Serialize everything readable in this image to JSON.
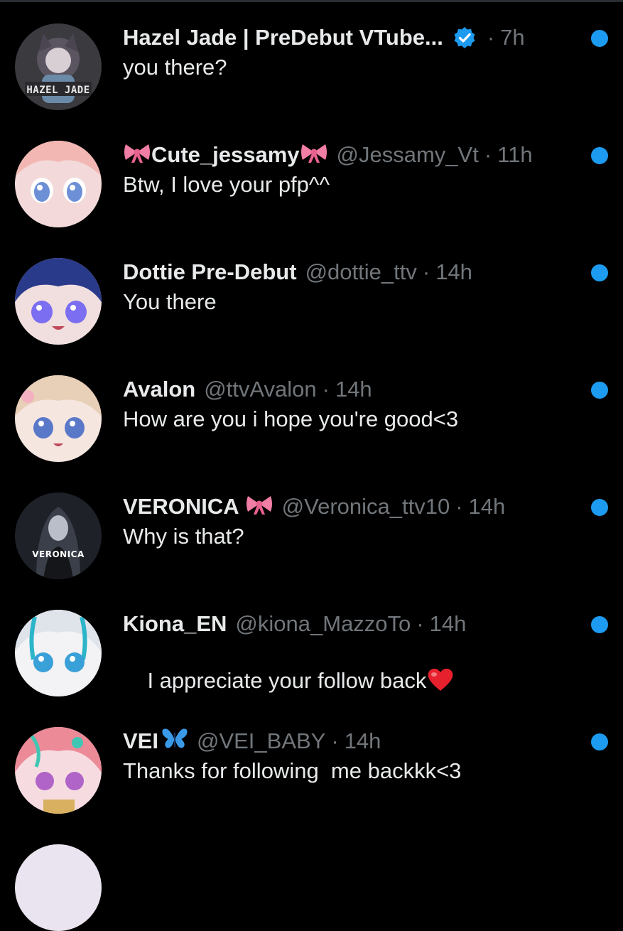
{
  "conversations": [
    {
      "name": "Hazel Jade | PreDebut VTube...",
      "verified": true,
      "handle": "",
      "time": "7h",
      "preview": "you there?",
      "avatar_caption": "HAZEL JADE",
      "unread": true
    },
    {
      "name": "Cute_jessamy",
      "name_emoji": "ribbon-emoji",
      "handle": "@Jessamy_Vt",
      "time": "11h",
      "preview": "Btw, I love your pfp^^",
      "unread": true
    },
    {
      "name": "Dottie Pre-Debut",
      "handle": "@dottie_ttv",
      "time": "14h",
      "preview": "You there",
      "unread": true
    },
    {
      "name": "Avalon",
      "handle": "@ttvAvalon",
      "time": "14h",
      "preview": "How are you i hope you're good<3",
      "unread": true
    },
    {
      "name": "VERONICA",
      "name_emoji": "ribbon-emoji",
      "handle": "@Veronica_ttv10",
      "time": "14h",
      "preview": "Why is that?",
      "avatar_caption": "VERONICA",
      "unread": true
    },
    {
      "name": "Kiona_EN",
      "handle": "@kiona_MazzoTo",
      "time": "14h",
      "preview": "I appreciate your follow back",
      "preview_emoji": "red-heart-emoji",
      "unread": true
    },
    {
      "name": "VEI",
      "name_emoji": "butterfly-emoji",
      "handle": "@VEI_BABY",
      "time": "14h",
      "preview": "Thanks for following  me backkk<3",
      "unread": true
    }
  ],
  "separator": "·",
  "colors": {
    "background": "#000000",
    "name": "#e7e9ea",
    "muted": "#71767b",
    "unread_dot": "#1d9bf0",
    "verified": "#1d9bf0"
  }
}
